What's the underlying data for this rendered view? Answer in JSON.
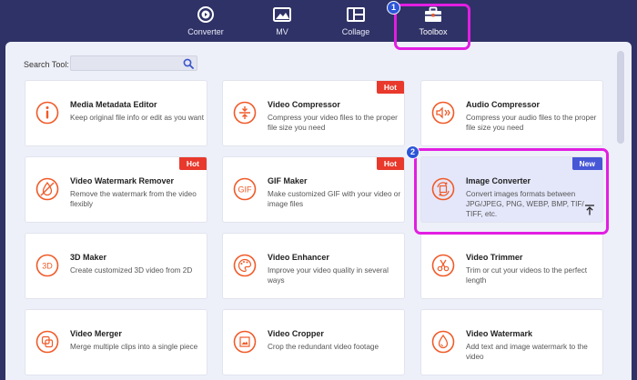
{
  "nav": {
    "tabs": [
      {
        "label": "Converter",
        "icon": "converter-icon"
      },
      {
        "label": "MV",
        "icon": "mv-icon"
      },
      {
        "label": "Collage",
        "icon": "collage-icon"
      },
      {
        "label": "Toolbox",
        "icon": "toolbox-icon",
        "active": true
      }
    ]
  },
  "steps": {
    "one": "1",
    "two": "2"
  },
  "search": {
    "label": "Search Tool:",
    "value": ""
  },
  "tools": [
    {
      "title": "Media Metadata Editor",
      "desc": "Keep original file info or edit as you want",
      "icon": "info-icon",
      "tag": ""
    },
    {
      "title": "Video Compressor",
      "desc": "Compress your video files to the proper file size you need",
      "icon": "compress-icon",
      "tag": "Hot"
    },
    {
      "title": "Audio Compressor",
      "desc": "Compress your audio files to the proper file size you need",
      "icon": "audio-compress-icon",
      "tag": ""
    },
    {
      "title": "Video Watermark Remover",
      "desc": "Remove the watermark from the video flexibly",
      "icon": "watermark-remove-icon",
      "tag": "Hot"
    },
    {
      "title": "GIF Maker",
      "desc": "Make customized GIF with your video or image files",
      "icon": "gif-icon",
      "tag": "Hot"
    },
    {
      "title": "Image Converter",
      "desc": "Convert images formats between JPG/JPEG, PNG, WEBP, BMP, TIF/ TIFF, etc.",
      "icon": "image-convert-icon",
      "tag": "New",
      "selected": true
    },
    {
      "title": "3D Maker",
      "desc": "Create customized 3D video from 2D",
      "icon": "3d-icon",
      "tag": ""
    },
    {
      "title": "Video Enhancer",
      "desc": "Improve your video quality in several ways",
      "icon": "palette-icon",
      "tag": ""
    },
    {
      "title": "Video Trimmer",
      "desc": "Trim or cut your videos to the perfect length",
      "icon": "scissors-icon",
      "tag": ""
    },
    {
      "title": "Video Merger",
      "desc": "Merge multiple clips into a single piece",
      "icon": "merge-icon",
      "tag": ""
    },
    {
      "title": "Video Cropper",
      "desc": "Crop the redundant video footage",
      "icon": "crop-icon",
      "tag": ""
    },
    {
      "title": "Video Watermark",
      "desc": "Add text and image watermark to the video",
      "icon": "drop-icon",
      "tag": ""
    }
  ],
  "icon_texts": {
    "gif": "GIF",
    "three_d": "3D"
  },
  "colors": {
    "accent": "#f05a28",
    "highlight": "#e21ee2",
    "nav_bg": "#2f3266"
  }
}
